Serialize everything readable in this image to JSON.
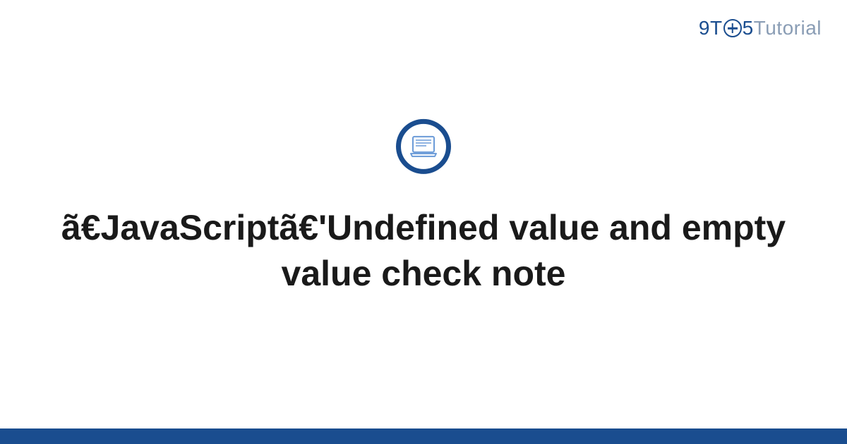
{
  "logo": {
    "part1": "9T",
    "part2": "5",
    "part3": "Tutorial"
  },
  "title": "ã€JavaScriptã€'Undefined value and empty value check note",
  "colors": {
    "brand": "#1a4d8f",
    "muted": "#8a9db5",
    "text": "#1a1a1a"
  }
}
